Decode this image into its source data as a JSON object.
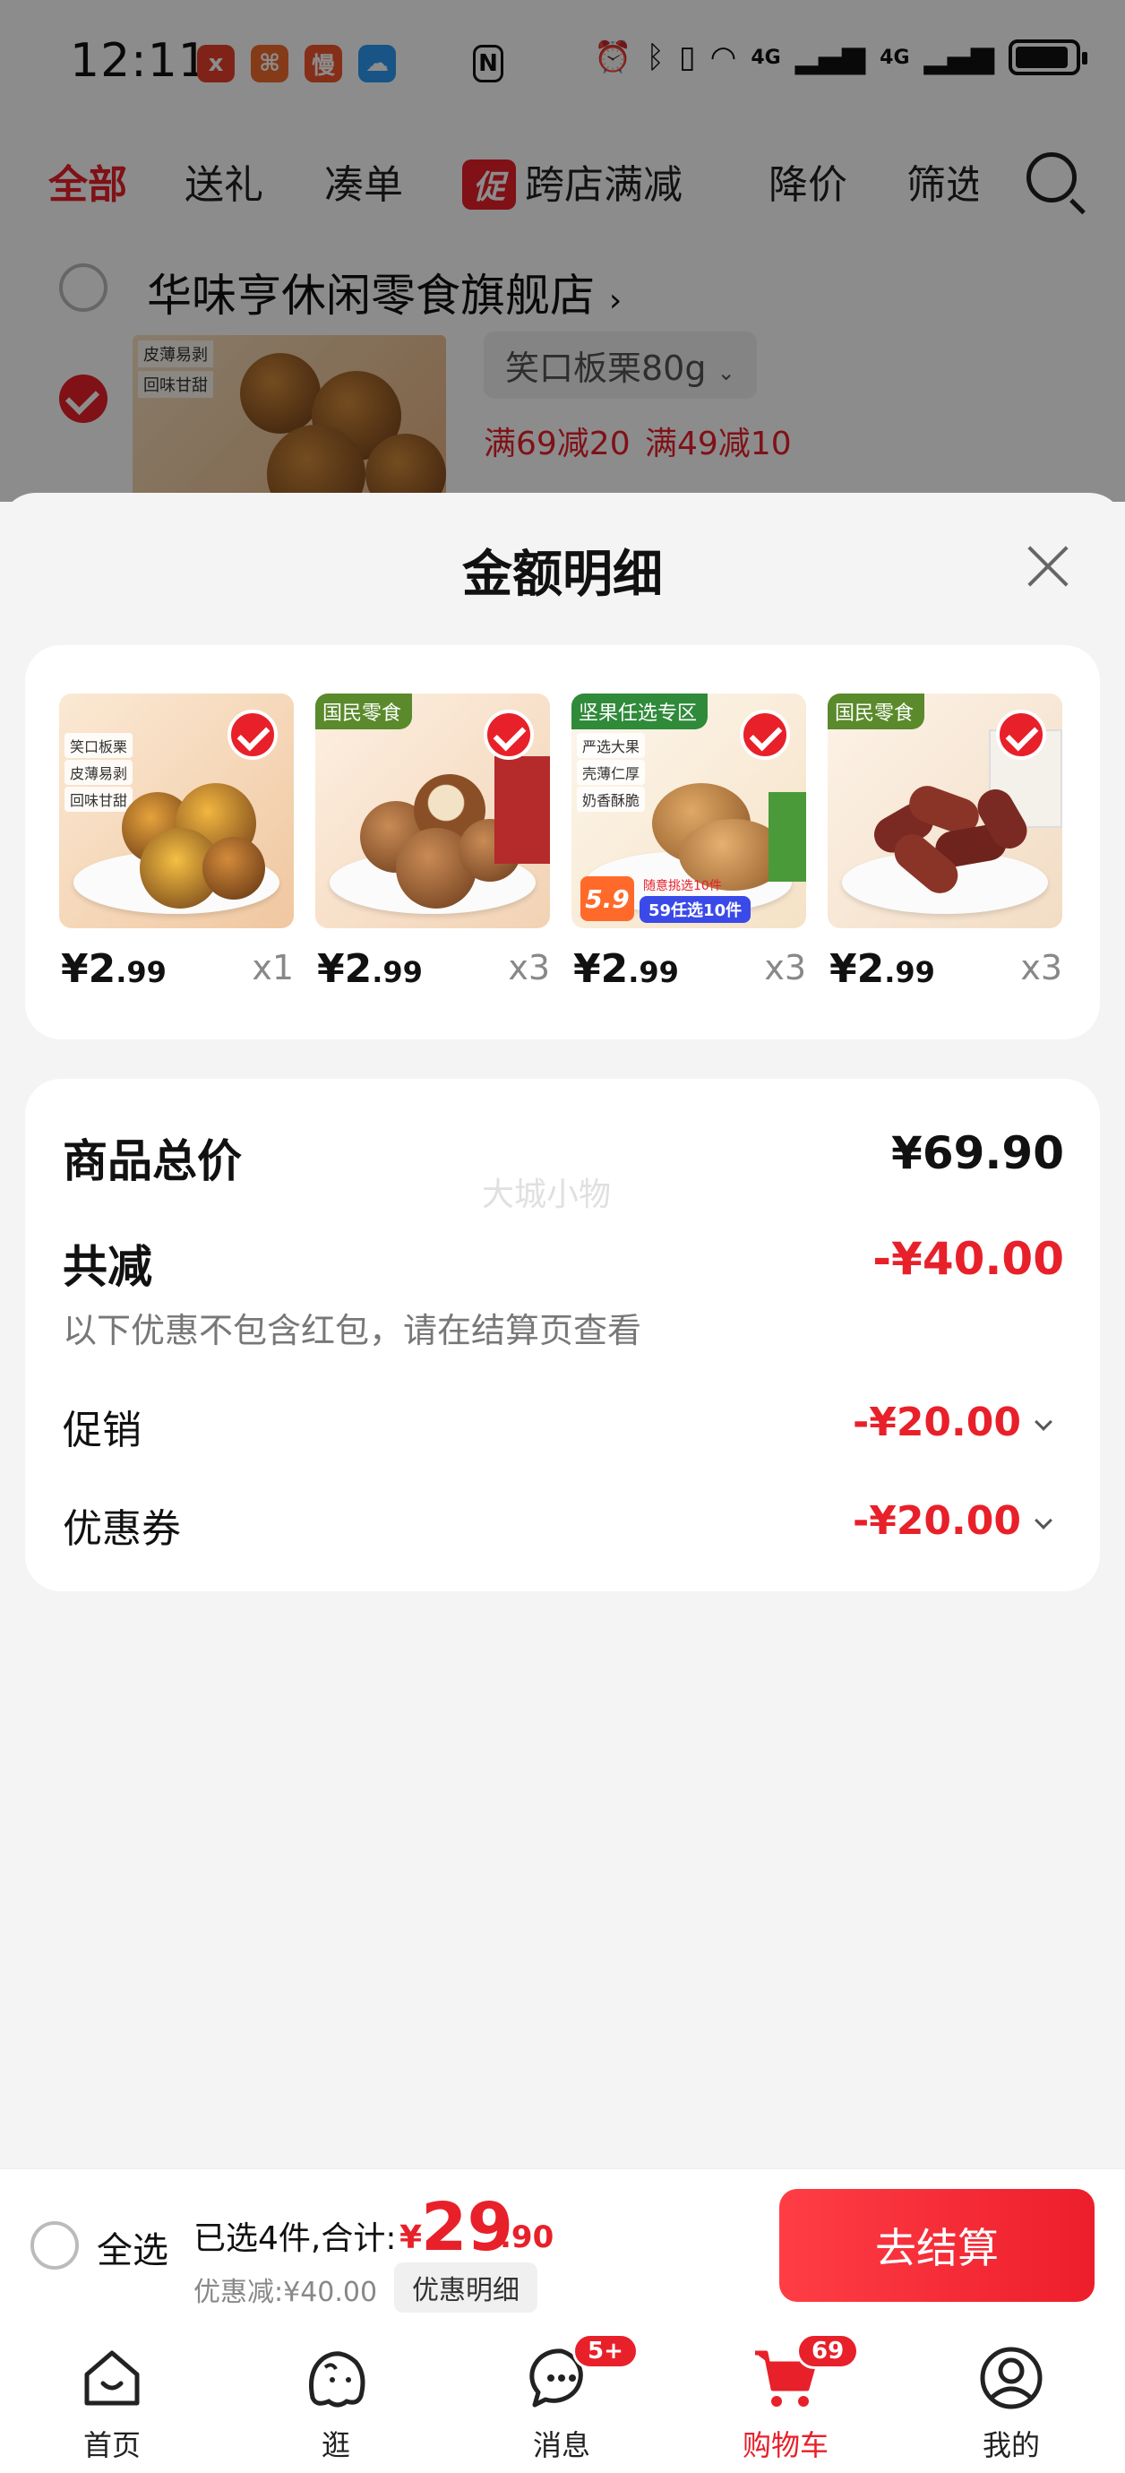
{
  "status_bar": {
    "time": "12:11",
    "apps": [
      "x",
      "⌘",
      "慢",
      "☁"
    ],
    "right_icons": [
      "nfc-icon",
      "alarm-icon",
      "bluetooth-icon",
      "vibrate-icon",
      "wifi-icon",
      "4g-signal-icon",
      "4g-signal-icon",
      "battery-icon"
    ],
    "network_labels": [
      "4G",
      "4G"
    ]
  },
  "top_tabs": {
    "items": [
      "全部",
      "送礼",
      "凑单",
      "跨店满减",
      "降价",
      "筛选"
    ],
    "promo_chip": "促",
    "active_index": 0
  },
  "shop": {
    "name": "华味亨休闲零食旗舰店",
    "thumb_labels": [
      "皮薄易剥",
      "回味甘甜"
    ],
    "variant": "笑口板栗80g",
    "promos": [
      "满69减20",
      "满49减10"
    ]
  },
  "sheet": {
    "title": "金额明细",
    "items": [
      {
        "price_int": "¥2",
        "price_dec": ".99",
        "qty": "x1",
        "labels": [
          "笑口板栗",
          "皮薄易剥",
          "回味甘甜"
        ],
        "brand": ""
      },
      {
        "price_int": "¥2",
        "price_dec": ".99",
        "qty": "x3",
        "labels": [],
        "brand": "国民零食"
      },
      {
        "price_int": "¥2",
        "price_dec": ".99",
        "qty": "x3",
        "labels": [
          "严选大果",
          "壳薄仁厚",
          "奶香酥脆"
        ],
        "brand": "坚果任选专区",
        "banner": "59任选10件",
        "banner_price": "5.9",
        "banner_sub": "随意挑选10件"
      },
      {
        "price_int": "¥2",
        "price_dec": ".99",
        "qty": "x3",
        "labels": [],
        "brand": "国民零食"
      }
    ],
    "summary": {
      "total_label": "商品总价",
      "total_value": "¥69.90",
      "reduce_label": "共减",
      "reduce_value": "-¥40.00",
      "note": "以下优惠不包含红包，请在结算页查看",
      "watermark": "大城小物",
      "lines": [
        {
          "label": "促销",
          "value": "-¥20.00"
        },
        {
          "label": "优惠券",
          "value": "-¥20.00"
        }
      ]
    }
  },
  "checkout": {
    "select_all": "全选",
    "selected": "已选4件,合计:",
    "total_symbol": "¥",
    "total_int": "29",
    "total_dec": ".90",
    "discount": "优惠减:¥40.00",
    "detail_button": "优惠明细",
    "checkout_button": "去结算"
  },
  "nav": {
    "items": [
      {
        "label": "首页",
        "icon": "home-icon"
      },
      {
        "label": "逛",
        "icon": "browse-icon"
      },
      {
        "label": "消息",
        "icon": "message-icon",
        "badge": "5+"
      },
      {
        "label": "购物车",
        "icon": "cart-icon",
        "badge": "69"
      },
      {
        "label": "我的",
        "icon": "profile-icon"
      }
    ],
    "active_index": 3
  },
  "colors": {
    "accent": "#e8202a",
    "background": "#f4f4f4",
    "card": "#ffffff"
  }
}
